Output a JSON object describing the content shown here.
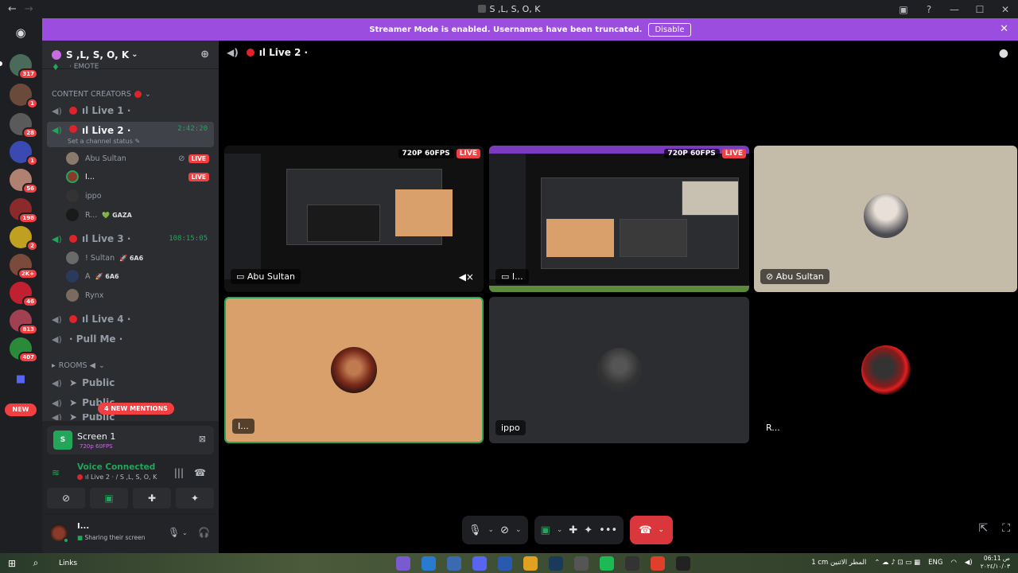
{
  "window": {
    "title": "S ,L, S, O, K"
  },
  "banner": {
    "text": "Streamer Mode is enabled. Usernames have been truncated.",
    "button": "Disable"
  },
  "rail": {
    "badges": [
      "317",
      "1",
      "28",
      "1",
      "56",
      "198",
      "2",
      "2K+",
      "46",
      "813",
      "407"
    ],
    "new_label": "NEW"
  },
  "server": {
    "name": "S ,L, S, O, K"
  },
  "sidebar": {
    "emote_partial": "· EMOTE",
    "category_creators": "CONTENT CREATORS",
    "channels": {
      "live1": "ıl Live 1 ·",
      "live2": "ıl Live 2 ·",
      "live2_timer": "2:42:20",
      "live2_status": "Set a channel status",
      "live3": "ıl Live 3 ·",
      "live3_timer": "108:15:05",
      "live4": "ıl Live 4 ·",
      "pullme": "· Pull Me ·"
    },
    "live2_users": [
      {
        "name": "Abu Sultan",
        "badge": "LIVE"
      },
      {
        "name": "I...",
        "badge": "LIVE"
      },
      {
        "name": "ippo"
      },
      {
        "name": "R...",
        "tag": "💚 GAZA"
      }
    ],
    "live3_users": [
      {
        "name": "! Sultan",
        "tag": "🚀 6A6"
      },
      {
        "name": "A",
        "tag": "🚀 6A6"
      },
      {
        "name": "Rynx"
      }
    ],
    "category_rooms": "ROOMS ◀",
    "rooms": [
      "Public",
      "Public",
      "Public"
    ],
    "mentions": "4 NEW MENTIONS"
  },
  "panel": {
    "screen_title": "Screen 1",
    "screen_quality": "720p 60FPS",
    "voice_status": "Voice Connected",
    "voice_channel": "ıl Live 2 · / S ,L, S, O, K",
    "user_name": "I...",
    "user_status": "Sharing their screen"
  },
  "main": {
    "channel_title": "ıl Live 2 ·",
    "tiles": [
      {
        "label": "Abu Sultan",
        "quality": "720P 60FPS",
        "live": "LIVE"
      },
      {
        "label": "I...",
        "quality": "720P 60FPS",
        "live": "LIVE"
      },
      {
        "label": "Abu Sultan"
      },
      {
        "label": "I..."
      },
      {
        "label": "ippo"
      },
      {
        "label": "R..."
      }
    ]
  },
  "taskbar": {
    "links": "Links",
    "weather": "1 cm  المطر الاثنين",
    "lang": "ENG",
    "time": "06:11 ص",
    "date": "٢٠٢٤/١٠/٠٣"
  },
  "colors": {
    "accent_purple": "#9b4de0",
    "live_red": "#f23f42",
    "voice_green": "#23a55a",
    "tile_tan": "#d9a06b"
  }
}
